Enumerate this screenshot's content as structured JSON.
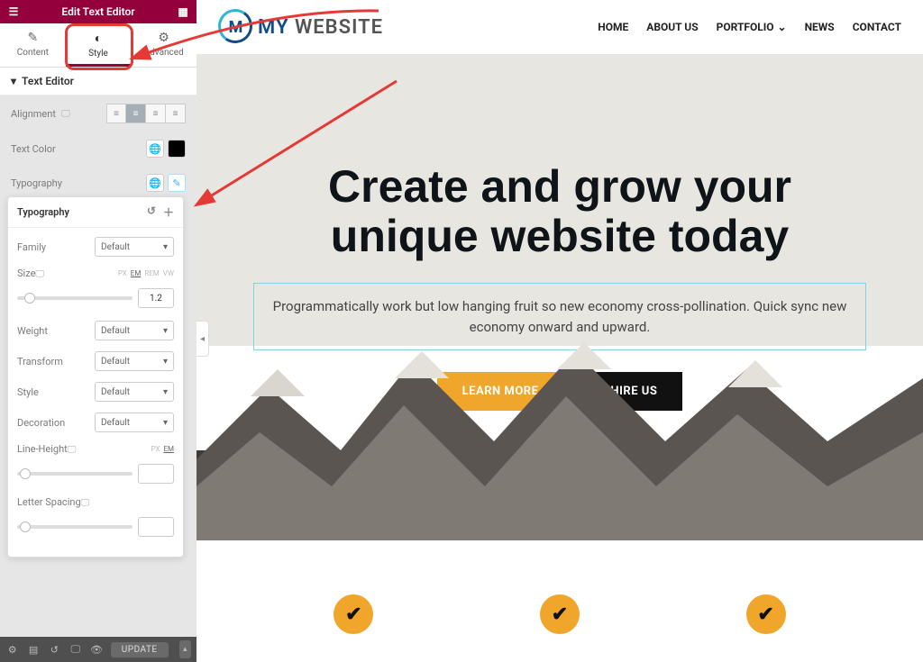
{
  "header": {
    "title": "Edit Text Editor"
  },
  "tabs": {
    "content": "Content",
    "style": "Style",
    "advanced": "Advanced"
  },
  "section": {
    "texteditor": "Text Editor"
  },
  "controls": {
    "alignment_label": "Alignment",
    "textcolor_label": "Text Color",
    "typography_label": "Typography"
  },
  "typography_pop": {
    "title": "Typography",
    "family_label": "Family",
    "family_value": "Default",
    "size_label": "Size",
    "size_value": "1.2",
    "units": {
      "px": "PX",
      "em": "EM",
      "rem": "REM",
      "vw": "VW"
    },
    "weight_label": "Weight",
    "weight_value": "Default",
    "transform_label": "Transform",
    "transform_value": "Default",
    "style_label": "Style",
    "style_value": "Default",
    "decoration_label": "Decoration",
    "decoration_value": "Default",
    "lineheight_label": "Line-Height",
    "letterspacing_label": "Letter Spacing"
  },
  "footer": {
    "update": "UPDATE"
  },
  "site": {
    "brand_prefix": "MY",
    "brand_suffix": " WEBSITE",
    "menu": {
      "home": "HOME",
      "about": "ABOUT US",
      "portfolio": "PORTFOLIO",
      "news": "NEWS",
      "contact": "CONTACT"
    },
    "headline1": "Create and grow your",
    "headline2": "unique website today",
    "sub": "Programmatically work but low hanging fruit so new economy cross-pollination. Quick sync new economy onward and upward.",
    "cta_learn": "LEARN MORE",
    "cta_hire": "HIRE US"
  }
}
